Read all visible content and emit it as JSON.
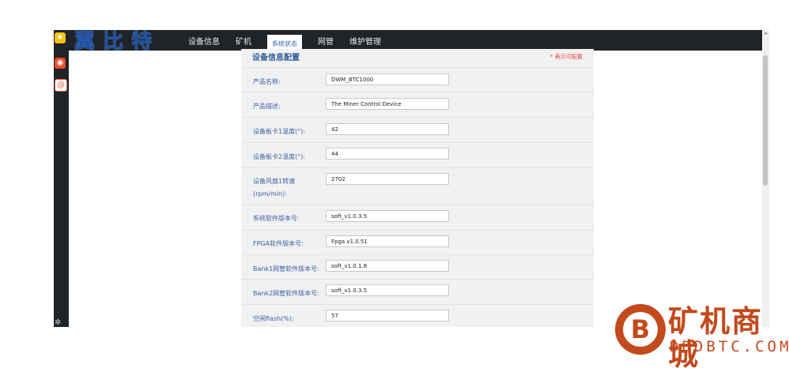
{
  "header": {
    "logo_text": "翼比特",
    "nav": [
      "设备信息",
      "矿机",
      "系统状态",
      "网管",
      "维护管理"
    ],
    "active_nav": "系统状态"
  },
  "panel": {
    "title": "设备信息配置",
    "required_note": "* 表示可配置",
    "fields": [
      {
        "label": "产品名称:",
        "value": "DWM_BTC1000"
      },
      {
        "label": "产品描述:",
        "value": "The Miner Control Device"
      },
      {
        "label": "设备板卡1温度(°):",
        "value": "42"
      },
      {
        "label": "设备板卡2温度(°):",
        "value": "44"
      },
      {
        "label": "设备风扇1转速",
        "label2": "(rpm/min):",
        "value": "2702"
      },
      {
        "label": "系统软件版本号:",
        "value": "soft_v1.0.3.5"
      },
      {
        "label": "FPGA软件版本号:",
        "value": "Fpga v1.0.51"
      },
      {
        "label": "Bank1网管软件版本号:",
        "value": "soft_v1.0.1.8"
      },
      {
        "label": "Bank2网管软件版本号:",
        "value": "soft_v1.0.3.5"
      },
      {
        "label": "空闲flash(%):",
        "value": "57"
      }
    ]
  },
  "watermark": {
    "symbol": "B",
    "title": "矿机商城",
    "subtitle": "DDDBTC.COM"
  },
  "colors": {
    "topbar": "#1f2428",
    "label": "#3b62a6",
    "watermark": "#c34a1c"
  }
}
